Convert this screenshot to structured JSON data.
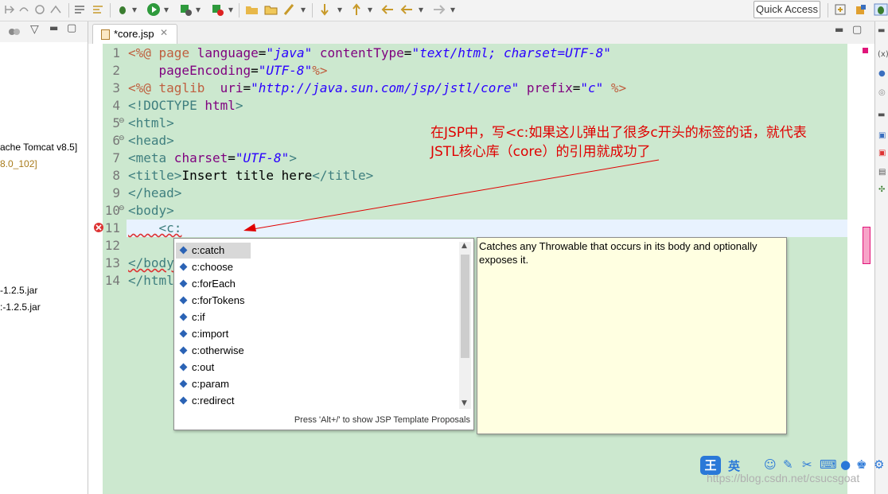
{
  "toolbar": {
    "quick_access": "Quick Access",
    "icons": [
      "back-icon",
      "forward-icon",
      "refresh-icon",
      "debug-icon",
      "run-icon",
      "external-tools-icon",
      "search-icon",
      "open-folder-icon",
      "next-annotation-icon",
      "prev-annotation-icon",
      "last-edit-icon",
      "nav-back-icon",
      "nav-forward-icon"
    ]
  },
  "left_panel": {
    "items": [
      "ache Tomcat v8.5]",
      "8.0_102]",
      "-1.2.5.jar",
      ":-1.2.5.jar"
    ]
  },
  "editor": {
    "tab_label": "*core.jsp",
    "tab_close": "✕",
    "line_numbers": [
      "1",
      "2",
      "3",
      "4",
      "5",
      "6",
      "7",
      "8",
      "9",
      "10",
      "11",
      "12",
      "13",
      "14"
    ],
    "lines": {
      "l1": {
        "d1": "<%@",
        "k1": " page ",
        "a1": "language",
        "e1": "=",
        "v1": "\"java\"",
        "a2": " contentType",
        "e2": "=",
        "v2": "\"text/html; charset=UTF-8\""
      },
      "l2": {
        "a1": "    pageEncoding",
        "e1": "=",
        "v1": "\"UTF-8\"",
        "d1": "%>"
      },
      "l3": {
        "d1": "<%@",
        "k1": " taglib ",
        "a1": " uri",
        "e1": "=",
        "v1": "\"http://java.sun.com/jsp/jstl/core\"",
        "a2": " prefix",
        "e2": "=",
        "v2": "\"c\"",
        "d2": " %>"
      },
      "l4": {
        "t1": "<!DOCTYPE",
        "t2": " html",
        ">": ">"
      },
      "l5": "<html>",
      "l6": "<head>",
      "l7": {
        "t1": "<meta",
        "a1": " charset",
        "e1": "=",
        "v1": "\"UTF-8\"",
        "t2": ">"
      },
      "l8": {
        "t1": "<title>",
        "p1": "Insert title here",
        "t2": "</title>"
      },
      "l9": "</head>",
      "l10": "<body>",
      "l11": "    <c:",
      "l13": "</body",
      "l14": "</html"
    }
  },
  "annotation": {
    "line1": "在JSP中，写<c:如果这儿弹出了很多c开头的标签的话，就代表",
    "line2": "JSTL核心库（core）的引用就成功了",
    "color": "#e00000"
  },
  "autocomplete": {
    "items": [
      "c:catch",
      "c:choose",
      "c:forEach",
      "c:forTokens",
      "c:if",
      "c:import",
      "c:otherwise",
      "c:out",
      "c:param",
      "c:redirect"
    ],
    "selected_index": 0,
    "footer": "Press 'Alt+/' to show JSP Template Proposals"
  },
  "doc_popup": {
    "text": "Catches any Throwable that occurs in its body and optionally exposes it."
  },
  "ime_bar": {
    "label_wang": "王",
    "label_lang": "英"
  },
  "watermark": "https://blog.csdn.net/csucsgoat",
  "colors": {
    "editor_bg": "#cce8cf",
    "directive": "#bf5f3f",
    "attribute": "#7f007f",
    "value": "#2a00ff",
    "tag": "#3f7f7f",
    "popup_bg": "#ffffe1"
  }
}
